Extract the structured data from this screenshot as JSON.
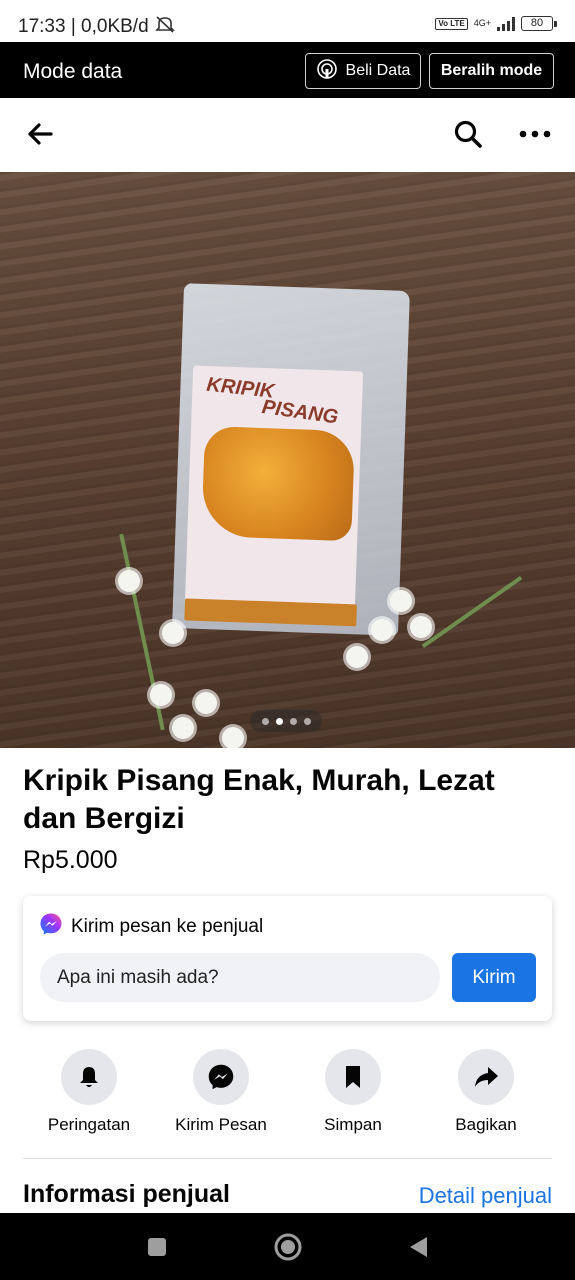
{
  "status_bar": {
    "time_speed": "17:33 | 0,0KB/d",
    "volte": "Vo LTE",
    "network": "4G+",
    "battery": "80"
  },
  "mode_bar": {
    "title": "Mode data",
    "buy_data_label": "Beli Data",
    "switch_mode_label": "Beralih mode"
  },
  "top_nav": {
    "icons": [
      "back-arrow-icon",
      "search-icon",
      "more-icon"
    ]
  },
  "photo": {
    "bag_text_line1": "KRIPIK",
    "bag_text_line2": "PISANG",
    "carousel_count": 4,
    "carousel_active": 2
  },
  "product": {
    "title": "Kripik Pisang Enak, Murah, Lezat dan Bergizi",
    "price": "Rp5.000"
  },
  "message_card": {
    "heading": "Kirim pesan ke penjual",
    "input_value": "Apa ini masih ada?",
    "send_label": "Kirim"
  },
  "actions": [
    {
      "label": "Peringatan",
      "icon": "bell-icon"
    },
    {
      "label": "Kirim Pesan",
      "icon": "messenger-icon"
    },
    {
      "label": "Simpan",
      "icon": "bookmark-icon"
    },
    {
      "label": "Bagikan",
      "icon": "share-icon"
    }
  ],
  "seller": {
    "heading": "Informasi penjual",
    "detail_link": "Detail penjual"
  },
  "colors": {
    "accent": "#1b74e4",
    "mode_bar_bg": "#000000",
    "chip_bg": "#e4e6eb"
  }
}
